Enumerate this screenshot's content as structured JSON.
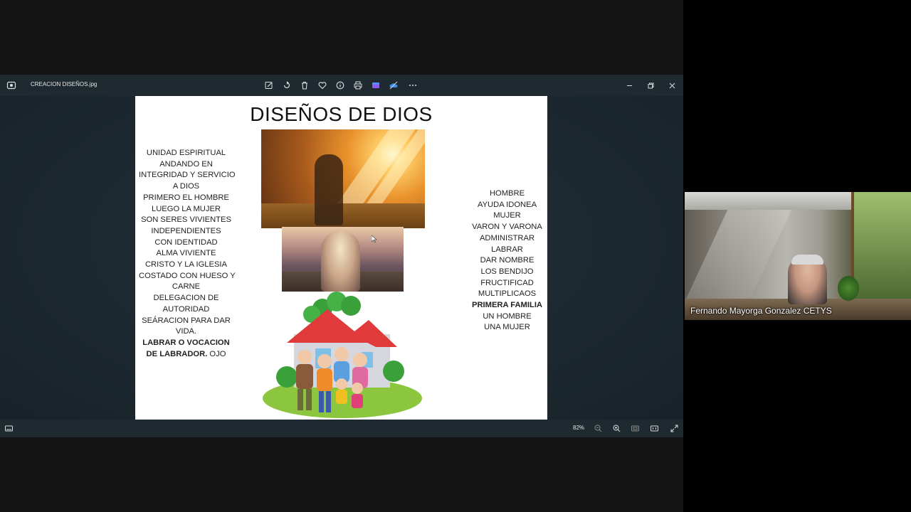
{
  "viewer": {
    "file_title": "CREACION DISEÑOS.jpg",
    "zoom": "82%",
    "toolbar_icons": [
      "edit-icon",
      "rotate-icon",
      "delete-icon",
      "favorite-icon",
      "info-icon",
      "print-icon",
      "clipchamp-icon",
      "onedrive-icon",
      "more-icon"
    ],
    "window_icons": [
      "minimize-icon",
      "restore-icon",
      "close-icon"
    ]
  },
  "slide": {
    "title": "DISEÑOS DE DIOS",
    "left_lines": [
      "UNIDAD ESPIRITUAL",
      "ANDANDO EN",
      "INTEGRIDAD Y SERVICIO",
      "A DIOS",
      "PRIMERO EL HOMBRE",
      "LUEGO LA MUJER",
      "SON SERES VIVIENTES",
      "INDEPENDIENTES",
      "CON IDENTIDAD",
      "ALMA VIVIENTE",
      "CRISTO Y LA IGLESIA",
      "COSTADO CON HUESO Y",
      "CARNE",
      "DELEGACION DE",
      "AUTORIDAD",
      "SEÁRACION PARA DAR",
      "VIDA."
    ],
    "left_bold_1": "LABRAR O VOCACION",
    "left_bold_2": "DE LABRADOR.",
    "left_tail": " OJO",
    "right_lines": [
      "HOMBRE",
      "AYUDA IDONEA",
      "MUJER",
      "VARON Y VARONA",
      "ADMINISTRAR",
      "LABRAR",
      "DAR NOMBRE",
      "LOS BENDIJO",
      "FRUCTIFICAD",
      "MULTIPLICAOS"
    ],
    "right_bold": "PRIMERA FAMILIA",
    "right_tail": [
      "UN HOMBRE",
      "UNA MUJER"
    ]
  },
  "video": {
    "participant_name": "Fernando Mayorga Gonzalez CETYS"
  },
  "colors": {
    "viewer_bg": "#1f2a30",
    "page_bg": "#131313",
    "slide_bg": "#ffffff"
  }
}
